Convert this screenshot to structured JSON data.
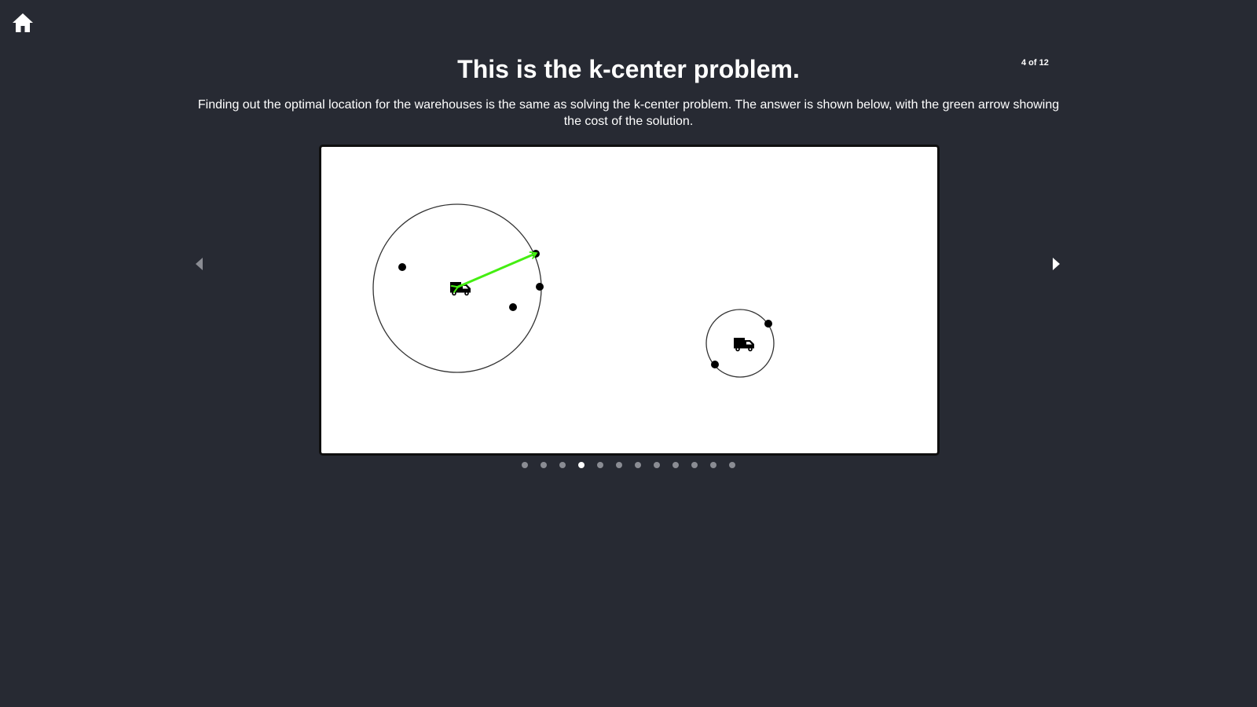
{
  "nav": {
    "home_icon": "home-icon",
    "prev_icon": "triangle-left-icon",
    "next_icon": "triangle-right-icon"
  },
  "slide": {
    "counter": "4 of 12",
    "title": "This is the k-center problem.",
    "description": "Finding out the optimal location for the warehouses is the same as solving the k-center problem. The answer is shown below, with the green arrow showing the cost of the solution."
  },
  "pagination": {
    "total": 12,
    "current": 4
  },
  "colors": {
    "background": "#272a33",
    "arrow": "#44ee11",
    "canvas": "#ffffff",
    "active_dot": "#ffffff",
    "inactive_dot": "#8a8c93"
  }
}
